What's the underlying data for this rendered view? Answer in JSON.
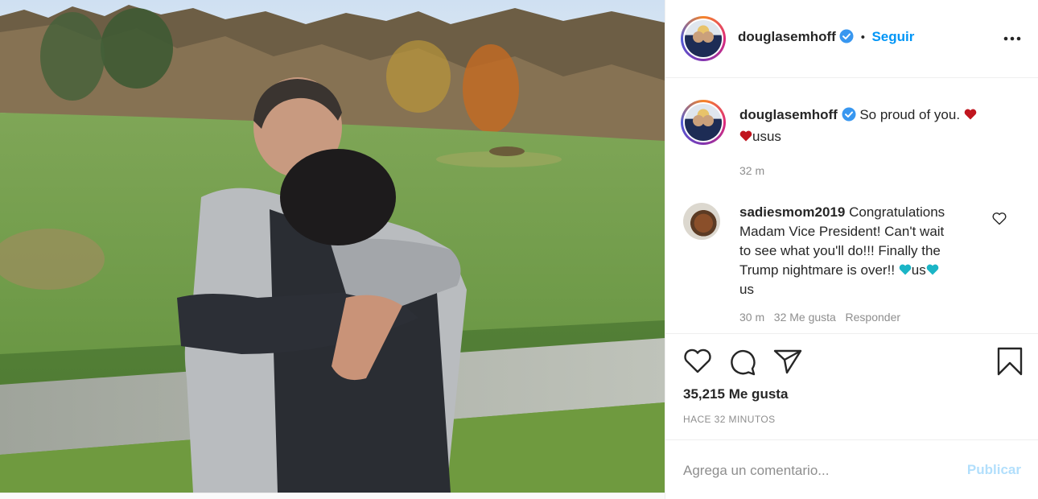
{
  "post": {
    "image_alt": "Two people embracing in a grassy field"
  },
  "header": {
    "username": "douglasemhoff",
    "separator": "•",
    "follow_label": "Seguir"
  },
  "caption": {
    "username": "douglasemhoff",
    "text": "So proud of you.",
    "flag_text": "usus",
    "time": "32 m"
  },
  "comment": {
    "username": "sadiesmom2019",
    "line1": "Congratulations",
    "line2": "Madam Vice President! Can't wait",
    "line3": "to see what you'll do!!! Finally the",
    "line4_a": "Trump nightmare is over!!",
    "line4_b": "us",
    "line5": "us",
    "meta_time": "30 m",
    "meta_likes": "32 Me gusta",
    "meta_reply": "Responder"
  },
  "actions": {
    "likes": "35,215 Me gusta",
    "posted_ago": "HACE 32 MINUTOS"
  },
  "add_comment": {
    "placeholder": "Agrega un comentario...",
    "publish_label": "Publicar"
  },
  "colors": {
    "link_blue": "#0095f6",
    "publish_disabled": "#b2dffc",
    "heart_red": "#c0151e",
    "heart_teal": "#1bb5c6",
    "muted": "#8e8e8e"
  }
}
